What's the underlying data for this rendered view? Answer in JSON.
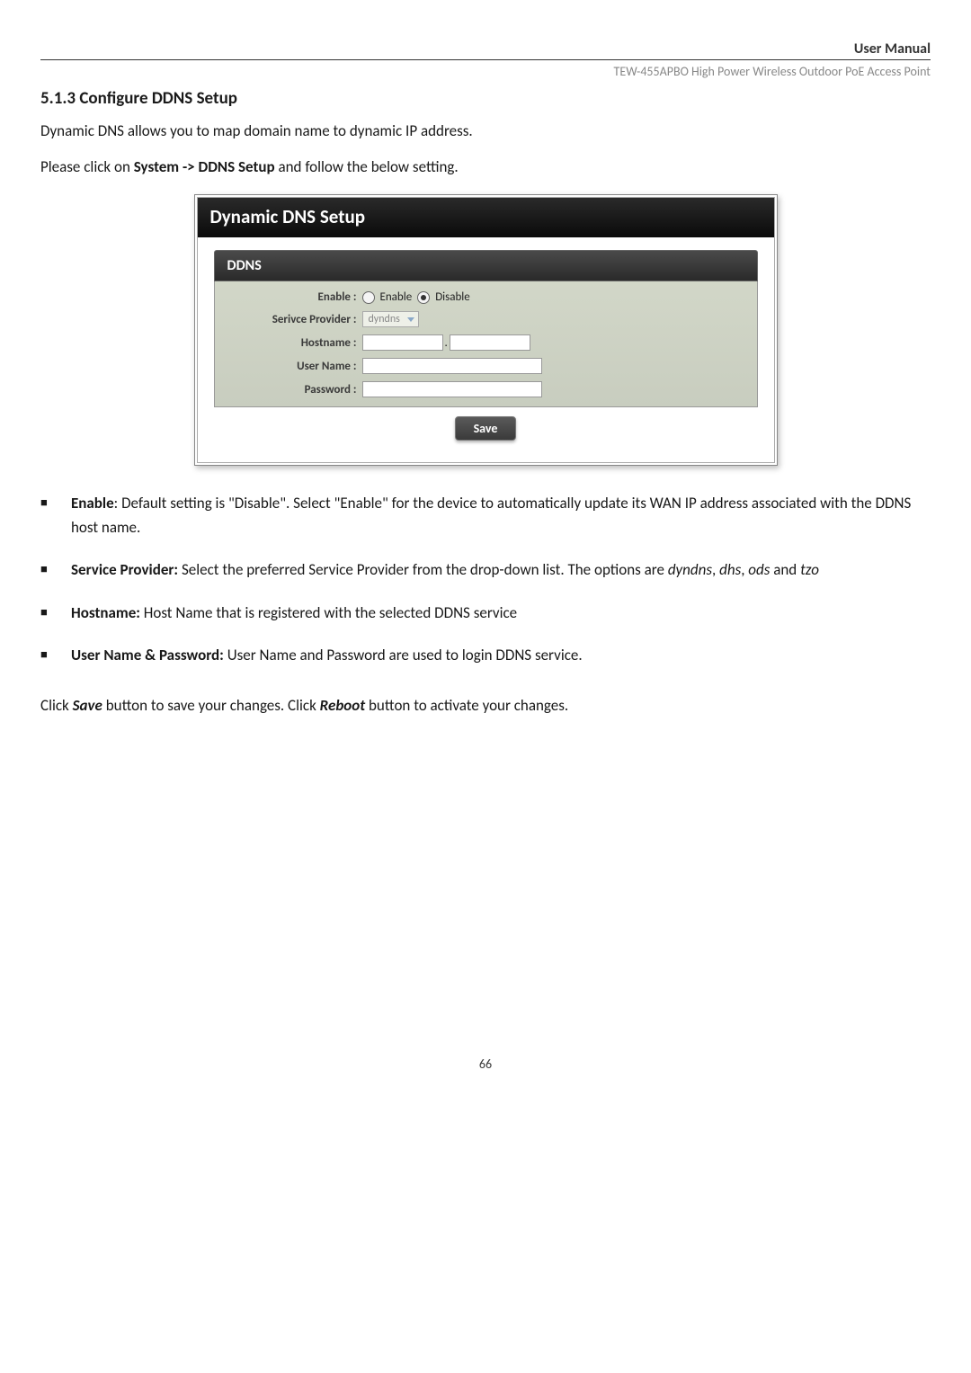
{
  "header": {
    "user_manual": "User Manual",
    "product": "TEW-455APBO High Power Wireless Outdoor PoE Access Point"
  },
  "section": {
    "title": "5.1.3 Configure DDNS Setup",
    "intro1": "Dynamic DNS allows you to map domain name to dynamic IP address.",
    "intro2_pre": "Please click on ",
    "intro2_bold": "System -> DDNS Setup",
    "intro2_post": " and follow the below setting."
  },
  "figure": {
    "title": "Dynamic DNS Setup",
    "section_header": "DDNS",
    "labels": {
      "enable": "Enable :",
      "provider": "Serivce Provider :",
      "hostname": "Hostname :",
      "username": "User Name :",
      "password": "Password :"
    },
    "options": {
      "enable": "Enable",
      "disable": "Disable",
      "provider_value": "dyndns"
    },
    "dot": ".",
    "save_button": "Save"
  },
  "bullets": [
    {
      "bold": "Enable",
      "sep": ": ",
      "text": "Default setting is \"Disable\". Select \"Enable\" for the device to automatically update its WAN IP address associated with the DDNS host name."
    },
    {
      "bold": "Service Provider:",
      "sep": " ",
      "text_pre": "Select the preferred Service Provider from the drop-down list. The options are  ",
      "italic1": "dyndns",
      "comma": ", ",
      "italic2": "dhs",
      "comma2": ", ",
      "italic3": "ods",
      "and": " and ",
      "italic4": "tzo"
    },
    {
      "bold": "Hostname:",
      "sep": " ",
      "text": "Host Name that is registered with the selected DDNS service"
    },
    {
      "bold": "User Name & Password:",
      "sep": " ",
      "text": "User Name and Password are used to login DDNS service."
    }
  ],
  "footer": {
    "pre": "Click ",
    "bold1": "Save",
    "mid": " button to save your changes. Click ",
    "bold2": "Reboot",
    "post": " button to activate your changes."
  },
  "page_number": "66"
}
